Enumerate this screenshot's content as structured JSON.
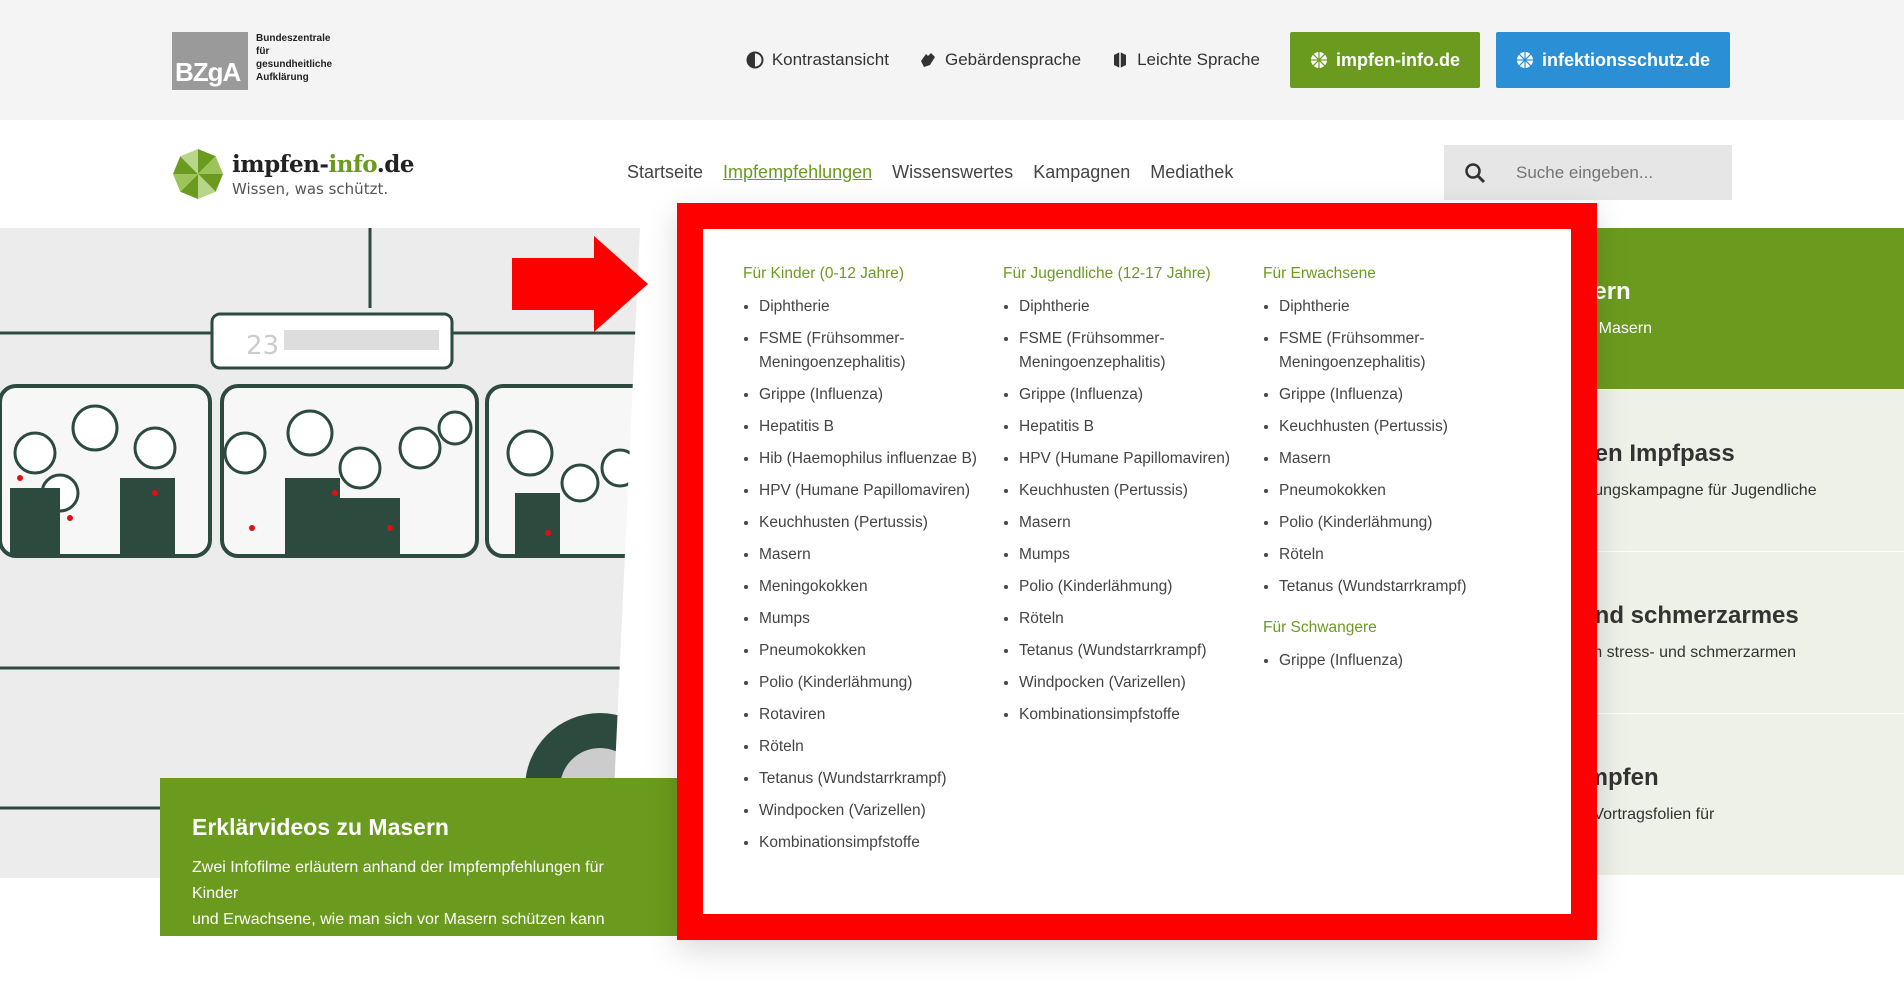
{
  "topbar": {
    "org_logo_text": "BZgA",
    "org_name_lines": [
      "Bundeszentrale",
      "für",
      "gesundheitliche",
      "Aufklärung"
    ],
    "links": [
      {
        "label": "Kontrastansicht",
        "icon": "contrast-icon"
      },
      {
        "label": "Gebärdensprache",
        "icon": "sign-language-icon"
      },
      {
        "label": "Leichte Sprache",
        "icon": "easy-language-icon"
      }
    ],
    "btn_impfen": "impfen-info.de",
    "btn_infektion": "infektionsschutz.de",
    "colors": {
      "green": "#6b9b1e",
      "blue": "#2b8fd6"
    }
  },
  "site": {
    "logo_main_a": "impfen-",
    "logo_main_b": "info",
    "logo_main_c": ".de",
    "logo_sub": "Wissen, was schützt."
  },
  "nav": {
    "items": [
      "Startseite",
      "Impfempfehlungen",
      "Wissenswertes",
      "Kampagnen",
      "Mediathek"
    ],
    "active": "Impfempfehlungen"
  },
  "search": {
    "placeholder": "Suche eingeben..."
  },
  "hero": {
    "bus_number": "23",
    "teaser_title": "Erklärvideos zu Masern",
    "teaser_text_1": "Zwei Infofilme erläutern anhand der Impfempfehlungen für Kinder",
    "teaser_text_2": "und Erwachsene, wie man sich vor Masern schützen kann"
  },
  "side": [
    {
      "title": "sern",
      "text": "or Masern"
    },
    {
      "title": "den Impfpass",
      "text": "ärungskampagne für Jugendliche"
    },
    {
      "title": "und schmerzarmes",
      "text": "um stress- und schmerzarmen"
    },
    {
      "title": "Impfen",
      "text": "t: Vortragsfolien für"
    }
  ],
  "mega": {
    "kinder": {
      "title": "Für Kinder (0-12 Jahre)",
      "items": [
        "Diphtherie",
        "FSME (Frühsommer-Meningoenzephalitis)",
        "Grippe (Influenza)",
        "Hepatitis B",
        "Hib (Haemophilus influenzae B)",
        "HPV (Humane Papillomaviren)",
        "Keuchhusten (Pertussis)",
        "Masern",
        "Meningokokken",
        "Mumps",
        "Pneumokokken",
        "Polio (Kinderlähmung)",
        "Rotaviren",
        "Röteln",
        "Tetanus (Wundstarrkrampf)",
        "Windpocken (Varizellen)",
        "Kombinationsimpfstoffe"
      ]
    },
    "jugendliche": {
      "title": "Für Jugendliche (12-17 Jahre)",
      "items": [
        "Diphtherie",
        "FSME (Frühsommer-Meningoenzephalitis)",
        "Grippe (Influenza)",
        "Hepatitis B",
        "HPV (Humane Papillomaviren)",
        "Keuchhusten (Pertussis)",
        "Masern",
        "Mumps",
        "Polio (Kinderlähmung)",
        "Röteln",
        "Tetanus (Wundstarrkrampf)",
        "Windpocken (Varizellen)",
        "Kombinationsimpfstoffe"
      ]
    },
    "erwachsene": {
      "title": "Für Erwachsene",
      "items": [
        "Diphtherie",
        "FSME (Frühsommer-Meningoenzephalitis)",
        "Grippe (Influenza)",
        "Keuchhusten (Pertussis)",
        "Masern",
        "Pneumokokken",
        "Polio (Kinderlähmung)",
        "Röteln",
        "Tetanus (Wundstarrkrampf)"
      ]
    },
    "schwangere": {
      "title": "Für Schwangere",
      "items": [
        "Grippe (Influenza)"
      ]
    },
    "highlight_color": "#ff0000"
  }
}
